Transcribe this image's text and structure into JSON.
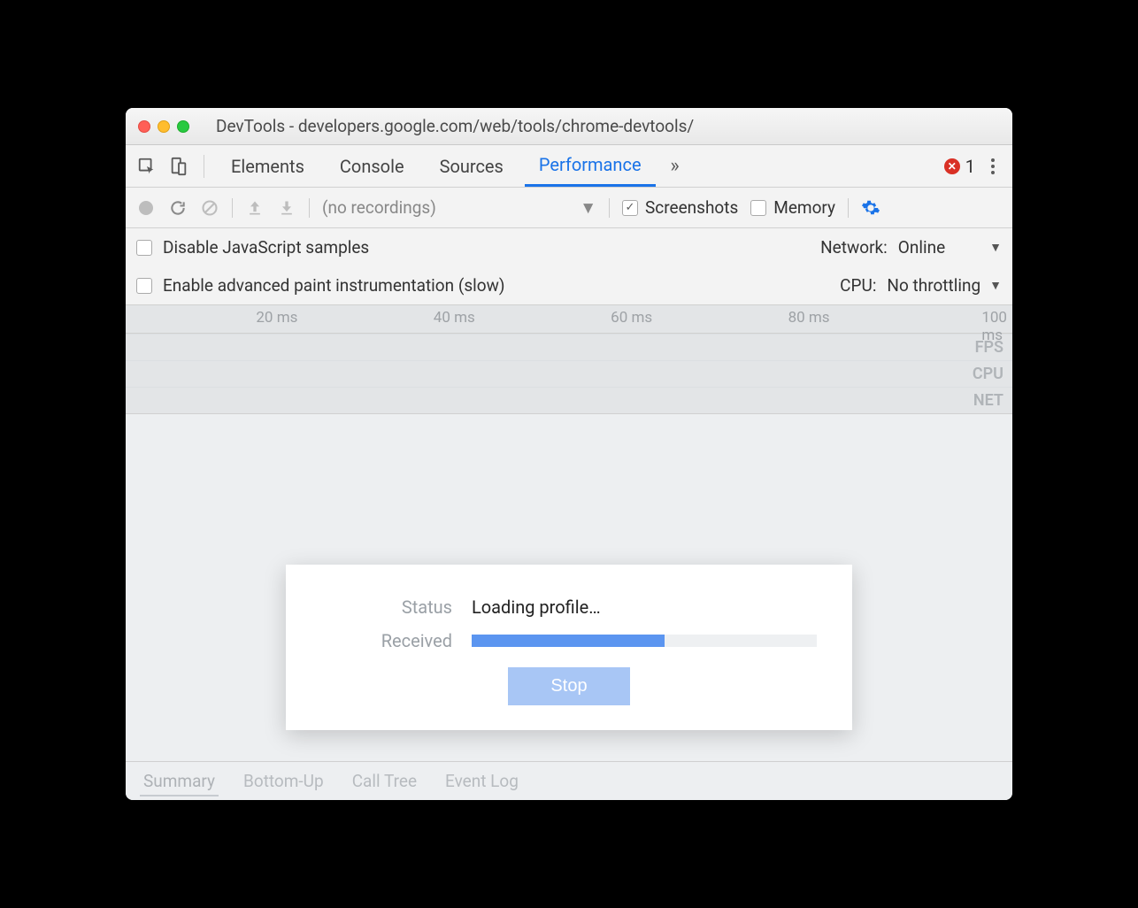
{
  "window": {
    "title": "DevTools - developers.google.com/web/tools/chrome-devtools/"
  },
  "tabs": {
    "elements": "Elements",
    "console": "Console",
    "sources": "Sources",
    "performance": "Performance",
    "error_count": "1"
  },
  "toolbar": {
    "recordings_label": "(no recordings)",
    "screenshots_label": "Screenshots",
    "memory_label": "Memory"
  },
  "settings": {
    "disable_js_label": "Disable JavaScript samples",
    "enable_paint_label": "Enable advanced paint instrumentation (slow)",
    "network_label": "Network:",
    "network_value": "Online",
    "cpu_label": "CPU:",
    "cpu_value": "No throttling"
  },
  "ruler": {
    "ticks": [
      "20 ms",
      "40 ms",
      "60 ms",
      "80 ms",
      "100 ms"
    ],
    "lanes": {
      "fps": "FPS",
      "cpu": "CPU",
      "net": "NET"
    }
  },
  "bottom_tabs": {
    "summary": "Summary",
    "bottom_up": "Bottom-Up",
    "call_tree": "Call Tree",
    "event_log": "Event Log"
  },
  "dialog": {
    "status_label": "Status",
    "status_value": "Loading profile…",
    "received_label": "Received",
    "progress_percent": 56,
    "stop_label": "Stop"
  }
}
